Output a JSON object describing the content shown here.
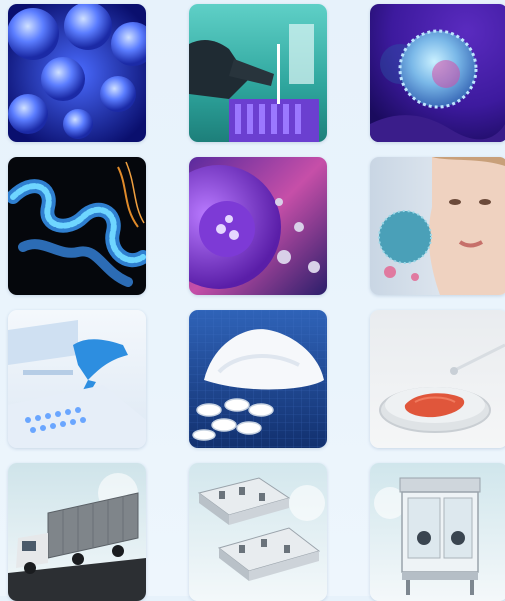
{
  "tiles": [
    {
      "name": "cell-culture-image"
    },
    {
      "name": "lab-pipetting-image"
    },
    {
      "name": "virus-particle-image"
    },
    {
      "name": "protein-strand-image"
    },
    {
      "name": "purple-cell-image"
    },
    {
      "name": "skincare-face-image"
    },
    {
      "name": "gloved-hand-plate-image"
    },
    {
      "name": "white-powder-tablets-image"
    },
    {
      "name": "petri-dish-tissue-image"
    },
    {
      "name": "mobile-lab-truck-image"
    },
    {
      "name": "cleanroom-layout-image"
    },
    {
      "name": "isolator-cabinet-image"
    }
  ],
  "colors": {
    "background": "#e9f3fc",
    "accent_blue": "#2c3ea8",
    "accent_purple": "#7a2bb0"
  }
}
